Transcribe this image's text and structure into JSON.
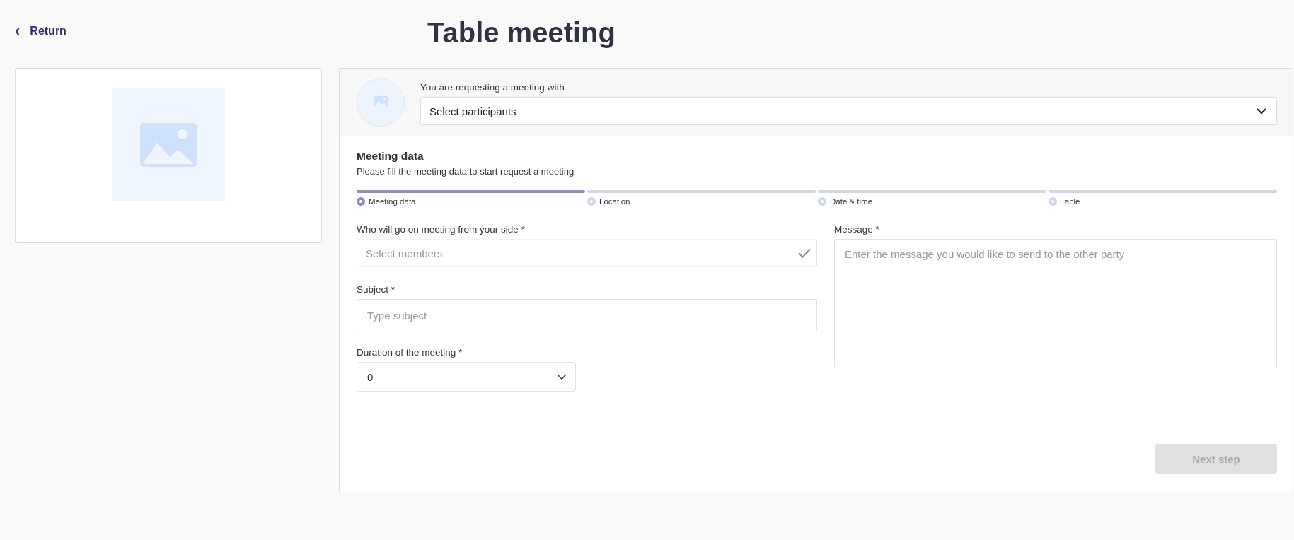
{
  "return_link": {
    "label": "Return",
    "icon": "‹"
  },
  "title": "Table meeting",
  "request": {
    "label": "You are requesting a meeting with",
    "select": {
      "value": "Select participants"
    }
  },
  "meeting_data": {
    "title": "Meeting data",
    "subtitle": "Please fill the meeting data to start request a meeting"
  },
  "steps": [
    {
      "label": "Meeting data",
      "selected": true
    },
    {
      "label": "Location",
      "selected": false
    },
    {
      "label": "Date & time",
      "selected": false
    },
    {
      "label": "Table",
      "selected": false
    }
  ],
  "fields": {
    "members": {
      "label": "Who will go on meeting from your side *",
      "placeholder": "Select members"
    },
    "subject": {
      "label": "Subject *",
      "placeholder": "Type subject"
    },
    "duration": {
      "label": "Duration of the meeting *",
      "value": "0"
    },
    "message": {
      "label": "Message *",
      "placeholder": "Enter the message you would like to send to the other party"
    }
  },
  "next_button": {
    "label": "Next step",
    "disabled": true
  }
}
